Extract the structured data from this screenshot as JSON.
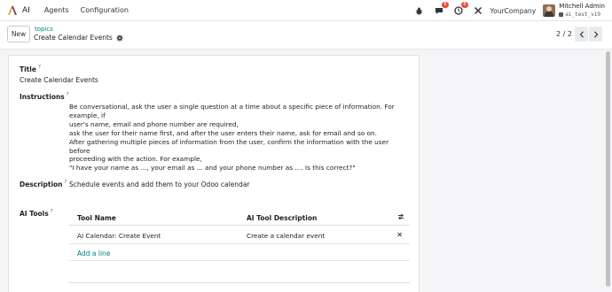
{
  "navbar": {
    "app_name": "AI",
    "menus": [
      "Agents",
      "Configuration"
    ],
    "activity_badge": "4",
    "messages_badge": "8",
    "timer_badge": "8",
    "company": "YourCompany",
    "user_name": "Mitchell Admin",
    "db_name": "ai_test_v19"
  },
  "control": {
    "new_label": "New",
    "breadcrumb_parent": "topics",
    "breadcrumb_current": "Create Calendar Events",
    "pager": "2 / 2"
  },
  "form": {
    "title_label": "Title",
    "title_help": "?",
    "title_value": "Create Calendar Events",
    "instructions_label": "Instructions",
    "instructions_help": "?",
    "instructions_lines": [
      "Be conversational, ask the user a single question at a time about a specific piece of information. For example, if",
      "user's name, email and phone number are required,",
      "ask the user for their name first, and after the user enters their name, ask for email and so on.",
      "After gathering multiple pieces of information from the user, confirm the information with the user before",
      "proceeding with the action. For example,",
      "\"I have your name as ..., your email as ... and your phone number as .... Is this correct?\""
    ],
    "description_label": "Description",
    "description_help": "?",
    "description_value": "Schedule events and add them to your Odoo calendar",
    "tools_label": "AI Tools",
    "tools_help": "?",
    "tools_table": {
      "headers": [
        "Tool Name",
        "AI Tool Description"
      ],
      "rows": [
        {
          "name": "AI Calendar: Create Event",
          "description": "Create a calendar event"
        }
      ],
      "add_line": "Add a line"
    }
  },
  "colors": {
    "accent": "#017e84",
    "badge": "#e74c3c",
    "brand_logo": "#714b67"
  }
}
